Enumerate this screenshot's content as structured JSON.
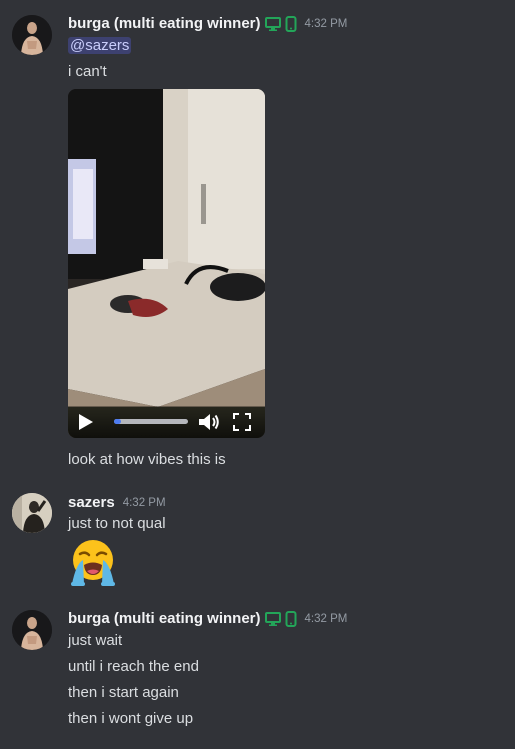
{
  "colors": {
    "background": "#313338",
    "username": "#f2f3f5",
    "text": "#dbdee1",
    "timestamp": "#949ba4",
    "online_green": "#23a559",
    "mention_bg": "#5865f24d"
  },
  "messages": [
    {
      "author": "burga (multi eating winner)",
      "time": "4:32 PM",
      "device_icons": [
        "desktop-icon",
        "mobile-icon"
      ],
      "mention": "@sazers",
      "lines": [
        "i can't"
      ],
      "attachment": {
        "type": "video",
        "progress": 0.1
      },
      "after_lines": [
        "look at how vibes this is"
      ]
    },
    {
      "author": "sazers",
      "time": "4:32 PM",
      "lines": [
        "just to not qual"
      ],
      "emoji": "loudly-crying-face-icon"
    },
    {
      "author": "burga (multi eating winner)",
      "time": "4:32 PM",
      "device_icons": [
        "desktop-icon",
        "mobile-icon"
      ],
      "lines": [
        "just wait",
        "until i reach the end",
        "then i start again",
        "then i wont give up"
      ]
    }
  ]
}
